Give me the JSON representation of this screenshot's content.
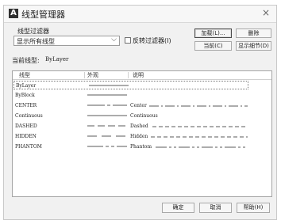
{
  "window": {
    "title": "线型管理器",
    "close_glyph": "×"
  },
  "filter": {
    "label": "线型过滤器",
    "selected": "显示所有线型",
    "invert_label": "反转过滤器(I)"
  },
  "buttons": {
    "load": "加载(L)...",
    "delete": "删除",
    "current": "当前(C)",
    "show_details": "显示细节(D)",
    "ok": "确定",
    "cancel": "取消",
    "help": "帮助(H)"
  },
  "current_linetype": {
    "label": "当前线型:",
    "value": "ByLayer"
  },
  "table": {
    "columns": [
      "线型",
      "外观",
      "说明"
    ],
    "rows": [
      {
        "name": "ByLayer",
        "pattern": "continuous",
        "description": "",
        "selected": true
      },
      {
        "name": "ByBlock",
        "pattern": "continuous",
        "description": ""
      },
      {
        "name": "CENTER",
        "pattern": "center",
        "description": "Center",
        "desc_pattern": "center"
      },
      {
        "name": "Continuous",
        "pattern": "continuous",
        "description": "Continuous"
      },
      {
        "name": "DASHED",
        "pattern": "dashed",
        "description": "Dashed",
        "desc_pattern": "dashed"
      },
      {
        "name": "HIDDEN",
        "pattern": "hidden",
        "description": "Hidden",
        "desc_pattern": "hidden"
      },
      {
        "name": "PHANTOM",
        "pattern": "phantom",
        "description": "Phantom",
        "desc_pattern": "phantom"
      }
    ]
  }
}
